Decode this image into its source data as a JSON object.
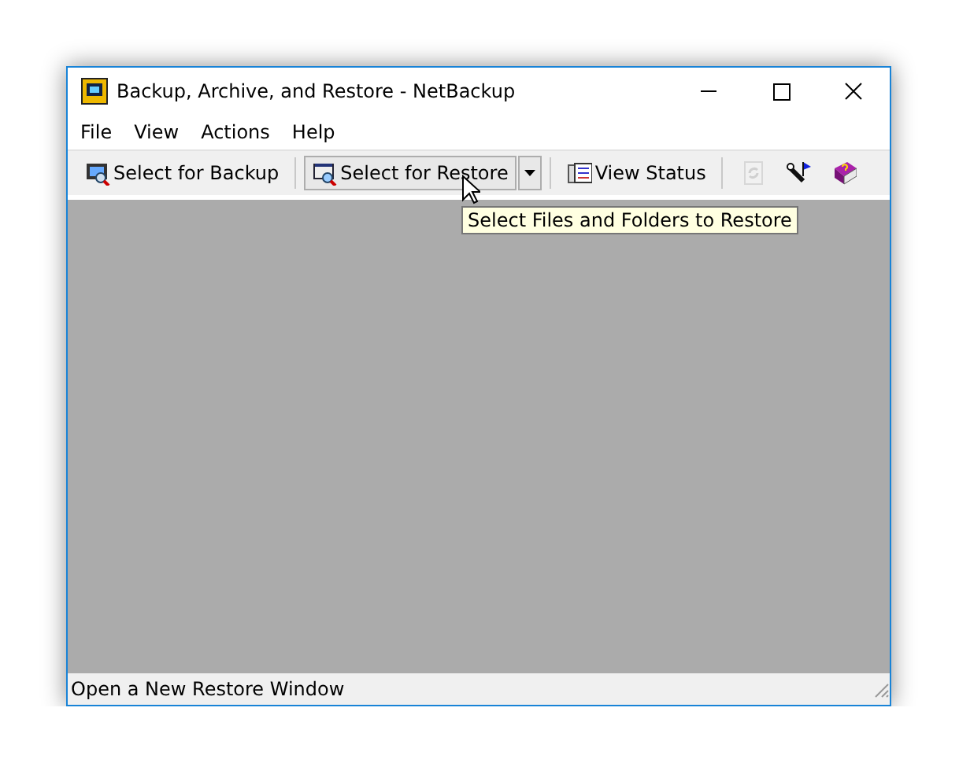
{
  "window": {
    "title": "Backup, Archive, and Restore - NetBackup"
  },
  "menu": [
    "File",
    "View",
    "Actions",
    "Help"
  ],
  "toolbar": [
    {
      "kind": "button",
      "label": "Select for Backup",
      "hovered": false
    },
    {
      "kind": "separator"
    },
    {
      "kind": "button",
      "label": "Select for Restore",
      "hovered": true
    },
    {
      "kind": "dropdown",
      "hovered": true
    },
    {
      "kind": "separator"
    },
    {
      "kind": "button",
      "label": "View Status",
      "hovered": false
    },
    {
      "kind": "separator"
    },
    {
      "kind": "icon",
      "disabled": true
    },
    {
      "kind": "icon",
      "disabled": false
    },
    {
      "kind": "icon",
      "disabled": false
    }
  ],
  "tooltip": "Select Files and Folders to Restore",
  "status_bar": "Open a New Restore Window"
}
